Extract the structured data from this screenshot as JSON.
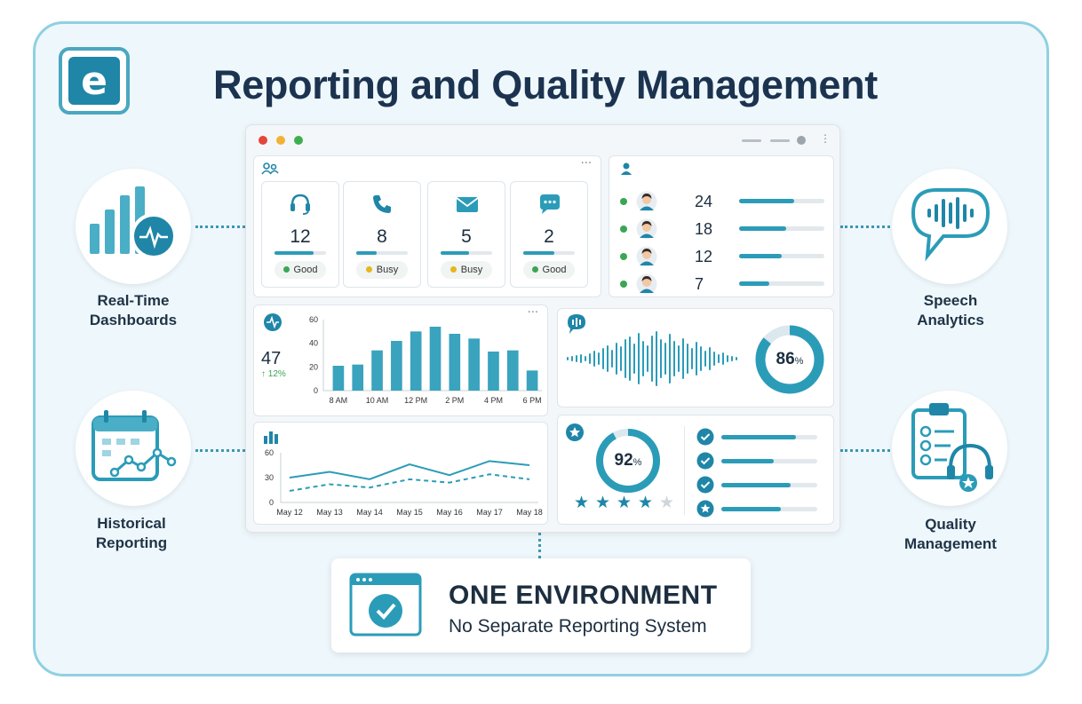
{
  "header": {
    "logo_letter": "e",
    "title": "Reporting and Quality Management"
  },
  "features": {
    "realtime": {
      "label_line1": "Real-Time",
      "label_line2": "Dashboards",
      "icon": "bar-chart-pulse-icon"
    },
    "historical": {
      "label_line1": "Historical",
      "label_line2": "Reporting",
      "icon": "calendar-trend-icon"
    },
    "speech": {
      "label_line1": "Speech",
      "label_line2": "Analytics",
      "icon": "speech-bubble-waveform-icon"
    },
    "quality": {
      "label_line1": "Quality",
      "label_line2": "Management",
      "icon": "clipboard-headset-icon"
    }
  },
  "dashboard": {
    "stats": [
      {
        "icon": "headset-icon",
        "value": "12",
        "status": "Good",
        "status_color": "#3aa655",
        "level": 0.75
      },
      {
        "icon": "phone-icon",
        "value": "8",
        "status": "Busy",
        "status_color": "#e8b51d",
        "level": 0.4
      },
      {
        "icon": "mail-icon",
        "value": "5",
        "status": "Busy",
        "status_color": "#e8b51d",
        "level": 0.55
      },
      {
        "icon": "chat-icon",
        "value": "2",
        "status": "Good",
        "status_color": "#3aa655",
        "level": 0.6
      }
    ],
    "agents": [
      {
        "value": "24",
        "level": 0.65
      },
      {
        "value": "18",
        "level": 0.55
      },
      {
        "value": "12",
        "level": 0.5
      },
      {
        "value": "7",
        "level": 0.35
      }
    ],
    "volume": {
      "value": "47",
      "change": "12%"
    },
    "speech_score": {
      "value": "86",
      "unit": "%"
    },
    "quality_score": {
      "value": "92",
      "unit": "%",
      "stars": 4,
      "stars_total": 5
    },
    "quality_checks": [
      {
        "icon": "check-circle-icon",
        "level": 0.78
      },
      {
        "icon": "check-circle-icon",
        "level": 0.55
      },
      {
        "icon": "check-circle-icon",
        "level": 0.72
      },
      {
        "icon": "star-circle-icon",
        "level": 0.62
      }
    ]
  },
  "chart_data": [
    {
      "type": "bar",
      "categories": [
        "8 AM",
        "",
        "10 AM",
        "",
        "12 PM",
        "",
        "2 PM",
        "",
        "4 PM",
        "",
        "6 PM"
      ],
      "values": [
        21,
        22,
        34,
        42,
        50,
        54,
        48,
        44,
        33,
        34,
        17
      ],
      "ylim": [
        0,
        60
      ],
      "yticks": [
        "0",
        "20",
        "40",
        "60"
      ]
    },
    {
      "type": "line",
      "categories": [
        "May 12",
        "May 13",
        "May 14",
        "May 15",
        "May 16",
        "May 17",
        "May 18"
      ],
      "series": [
        {
          "values": [
            30,
            37,
            28,
            46,
            33,
            50,
            45
          ]
        },
        {
          "values": [
            14,
            22,
            18,
            28,
            24,
            34,
            28
          ]
        }
      ],
      "ylim": [
        0,
        60
      ],
      "yticks": [
        "0",
        "30",
        "60"
      ]
    }
  ],
  "colors": {
    "accent": "#2b9cb8",
    "dark_accent": "#1f86a8",
    "title": "#1c3350"
  },
  "environment": {
    "title": "ONE ENVIRONMENT",
    "subtitle": "No Separate Reporting System",
    "icon": "browser-check-icon"
  }
}
